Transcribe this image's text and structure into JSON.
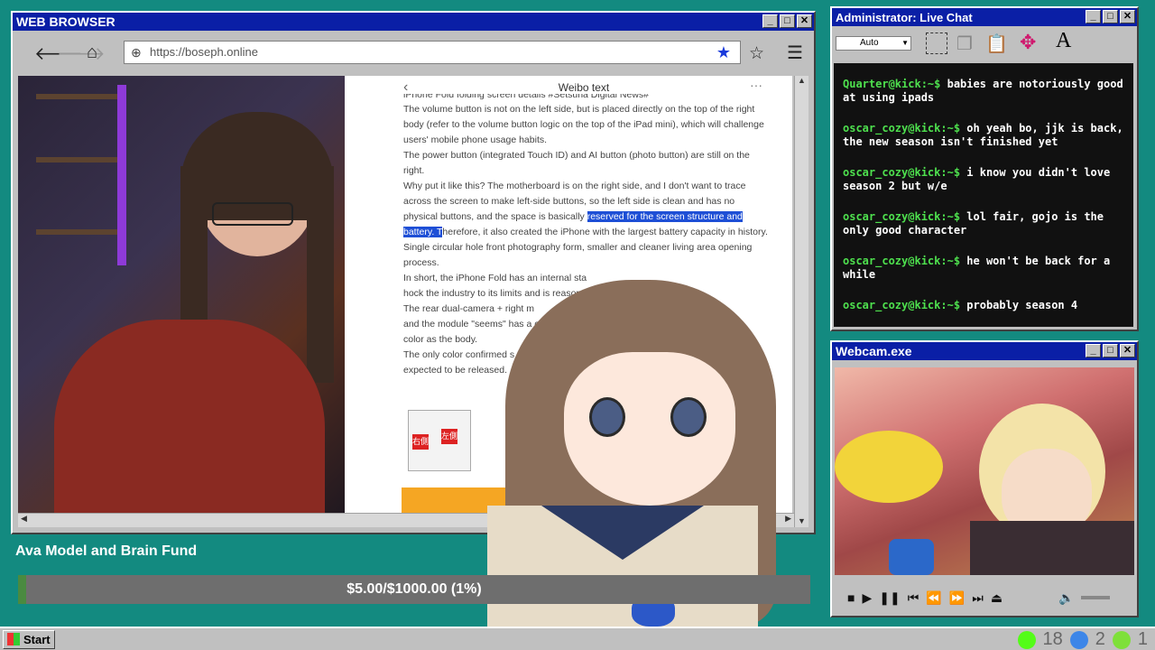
{
  "browser": {
    "title": "WEB BROWSER",
    "url": "https://boseph.online",
    "page_header": "Weibo text",
    "article": {
      "top_fragment": "iPhone Fold folding screen details #Setsuna Digital News#",
      "p1": "The volume button is not on the left side, but is placed directly on the top of the right body (refer to the volume button logic on the top of the iPad mini), which will challenge users' mobile phone usage habits.",
      "p2": "The power button (integrated Touch ID) and AI button (photo button) are still on the right.",
      "p3a": "Why put it like this? The motherboard is on the right side, and I don't want to trace across the screen to make left-side buttons, so the left side is clean and has no physical buttons, and the space is basically ",
      "p3_highlight": "reserved for the screen structure and battery. T",
      "p3b": "herefore, it also created the iPhone with the largest battery capacity in history.",
      "p4": "Single circular hole front photography form, smaller and cleaner living area opening process.",
      "p5a": "In short, the iPhone Fold has an internal sta",
      "p5b": "hock the industry to its limits and is reason",
      "p6a": "The rear dual-camera + right m",
      "p6b": "and the module \"seems\" has a co",
      "p6c": "color as the body.",
      "p7a": "The only color confirmed s",
      "p7b": "expected to be released.",
      "img_labels": [
        "右側",
        "左側"
      ]
    }
  },
  "chat": {
    "title": "Administrator: Live Chat",
    "font_select": "Auto",
    "messages": [
      {
        "user": "Quarter@kick:~$",
        "text": " babies are notoriously good at using ipads"
      },
      {
        "user": "oscar_cozy@kick:~$",
        "text": " oh yeah bo, jjk is back, the new season isn't finished yet"
      },
      {
        "user": "oscar_cozy@kick:~$",
        "text": " i know you didn't love season 2 but w/e"
      },
      {
        "user": "oscar_cozy@kick:~$",
        "text": " lol fair, gojo is the only good character"
      },
      {
        "user": "oscar_cozy@kick:~$",
        "text": " he won't be back for a while"
      },
      {
        "user": "oscar_cozy@kick:~$",
        "text": " probably season 4"
      }
    ]
  },
  "webcam": {
    "title": "Webcam.exe"
  },
  "fund": {
    "title": "Ava Model and Brain Fund",
    "progress_text": "$5.00/$1000.00 (1%)",
    "progress_fraction": 0.01
  },
  "taskbar": {
    "start_label": "Start",
    "counts": [
      "18",
      "2",
      "1"
    ]
  },
  "colors": {
    "desktop": "#138a80",
    "titlebar": "#0a1fa6",
    "chat_username": "#4ee04e"
  }
}
